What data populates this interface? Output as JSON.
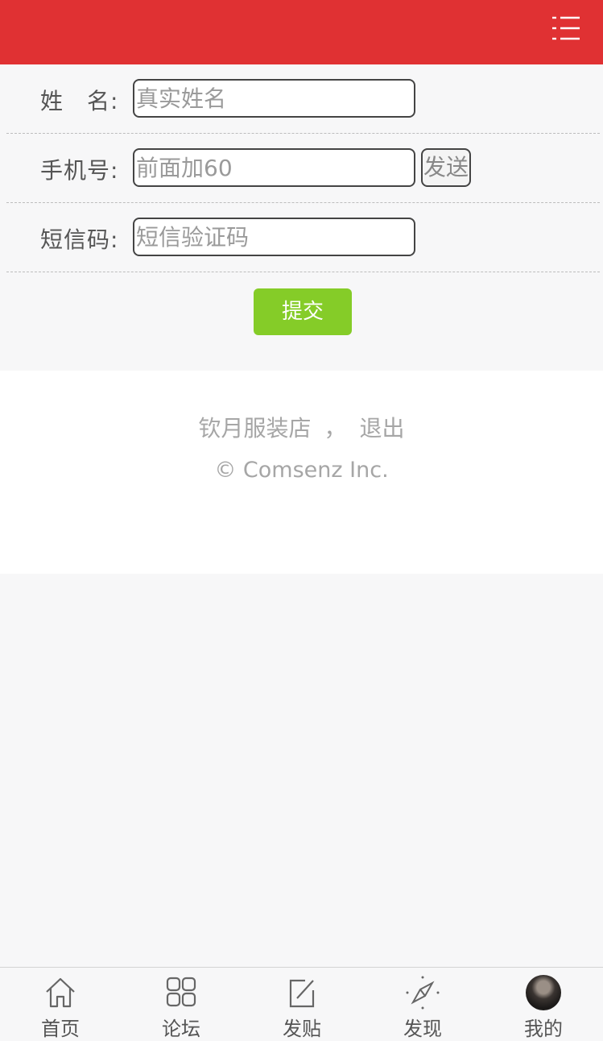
{
  "form": {
    "name_label": "姓　名:",
    "name_placeholder": "真实姓名",
    "phone_label": "手机号:",
    "phone_placeholder": "前面加60",
    "send_label": "发送",
    "code_label": "短信码:",
    "code_placeholder": "短信验证码",
    "submit_label": "提交"
  },
  "footer": {
    "shop_link": "钦月服装店",
    "separator": "，",
    "logout_link": "退出",
    "copyright": "© Comsenz Inc."
  },
  "tabbar": {
    "items": [
      {
        "label": "首页",
        "icon": "home-icon"
      },
      {
        "label": "论坛",
        "icon": "grid-icon"
      },
      {
        "label": "发贴",
        "icon": "compose-icon"
      },
      {
        "label": "发现",
        "icon": "compass-icon"
      },
      {
        "label": "我的",
        "icon": "avatar"
      }
    ]
  },
  "colors": {
    "header": "#e03133",
    "submit": "#85cc28",
    "background": "#f7f7f8"
  }
}
